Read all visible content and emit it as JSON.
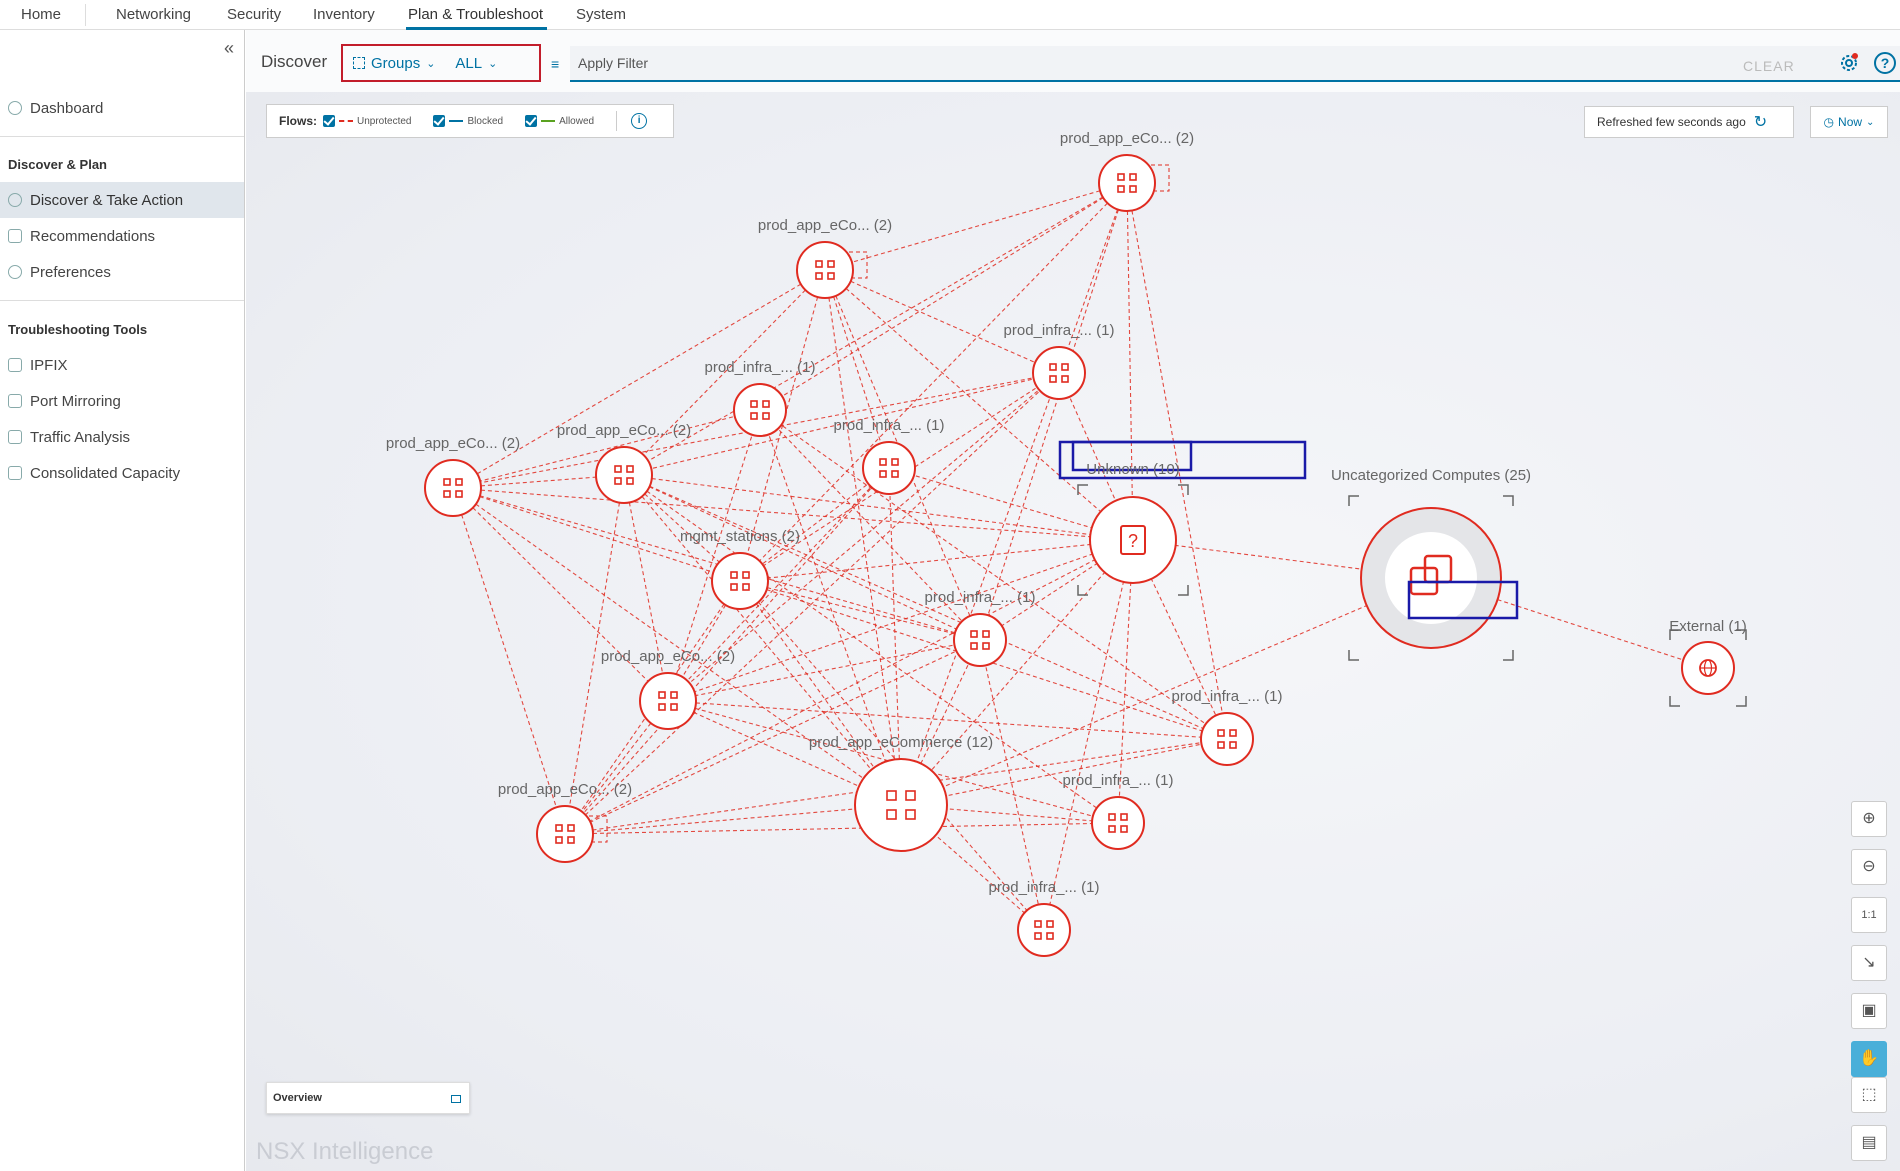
{
  "topnav": {
    "items": [
      "Home",
      "Networking",
      "Security",
      "Inventory",
      "Plan & Troubleshoot",
      "System"
    ],
    "active": "Plan & Troubleshoot"
  },
  "sidebar": {
    "dashboard": "Dashboard",
    "section_discover": "Discover & Plan",
    "discover_take_action": "Discover & Take Action",
    "recommendations": "Recommendations",
    "preferences": "Preferences",
    "section_tools": "Troubleshooting Tools",
    "ipfix": "IPFIX",
    "port_mirroring": "Port Mirroring",
    "traffic_analysis": "Traffic Analysis",
    "consolidated_capacity": "Consolidated Capacity"
  },
  "toolbar": {
    "title": "Discover",
    "groups_label": "Groups",
    "scope_label": "ALL",
    "filter_placeholder": "Apply Filter",
    "clear_label": "CLEAR"
  },
  "flows": {
    "label": "Flows:",
    "unprotected": "Unprotected",
    "blocked": "Blocked",
    "allowed": "Allowed",
    "colors": {
      "unprotected": "#e02b20",
      "blocked": "#0072a3",
      "allowed": "#5aa220"
    }
  },
  "refresh": {
    "text": "Refreshed few seconds ago",
    "time_label": "Now"
  },
  "graph": {
    "nodes": [
      {
        "id": "n1",
        "label": "prod_app_eCo... (2)"
      },
      {
        "id": "n2",
        "label": "prod_app_eCo... (2)"
      },
      {
        "id": "n3",
        "label": "prod_infra_... (1)"
      },
      {
        "id": "n4",
        "label": "prod_infra_... (1)"
      },
      {
        "id": "n5",
        "label": "prod_app_eCo... (2)"
      },
      {
        "id": "n6",
        "label": "prod_app_eCo... (2)"
      },
      {
        "id": "n7",
        "label": "prod_infra_... (1)"
      },
      {
        "id": "n8",
        "label": "Unknown (10)"
      },
      {
        "id": "n9",
        "label": "mgmt_stations (2)"
      },
      {
        "id": "n10",
        "label": "prod_infra_... (1)"
      },
      {
        "id": "n11",
        "label": "prod_app_eCo... (2)"
      },
      {
        "id": "n12",
        "label": "prod_infra_... (1)"
      },
      {
        "id": "n13",
        "label": "prod_app_eCommerce (12)"
      },
      {
        "id": "n14",
        "label": "prod_app_eCo... (2)"
      },
      {
        "id": "n15",
        "label": "prod_infra_... (1)"
      },
      {
        "id": "n16",
        "label": "prod_infra_... (1)"
      },
      {
        "id": "n17",
        "label": "Uncategorized Computes (25)"
      },
      {
        "id": "n18",
        "label": "External (1)"
      }
    ]
  },
  "overview_label": "Overview",
  "brand": "NSX Intelligence"
}
